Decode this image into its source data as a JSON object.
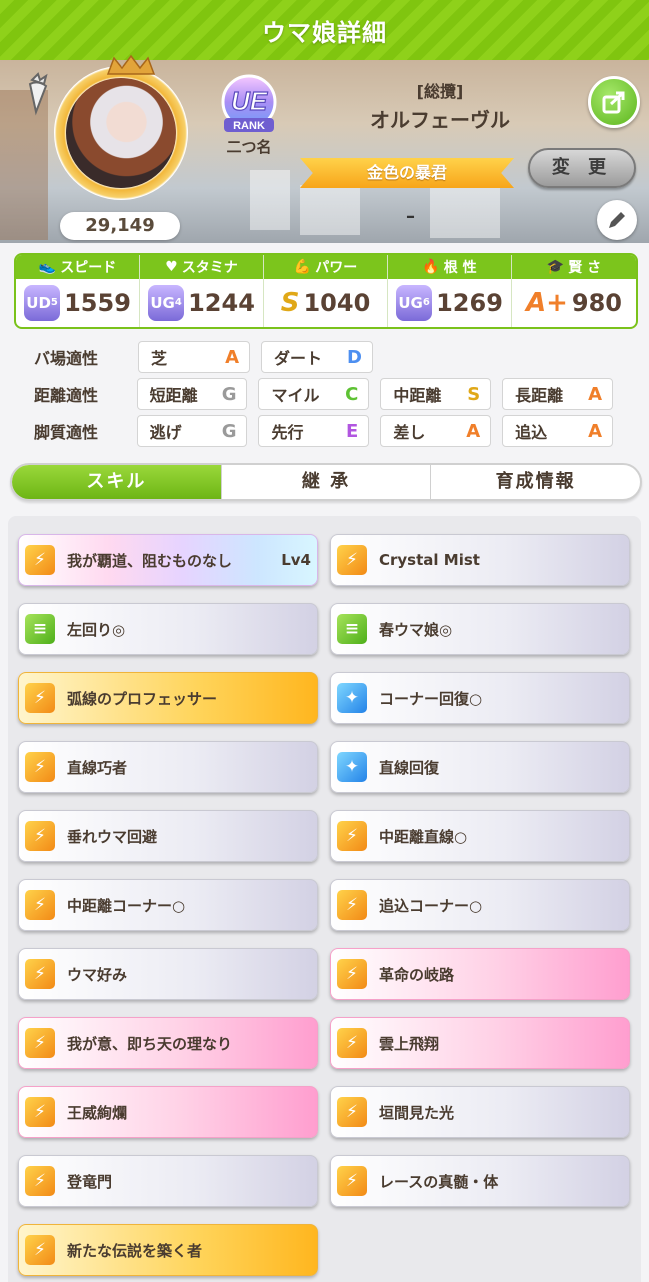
{
  "title": "ウマ娘詳細",
  "profile": {
    "fans": "29,149",
    "rank_label": "UE",
    "rank_word": "RANK",
    "rank_sub": "二つ名",
    "title_tag": "[総攬]",
    "name": "オルフェーヴル",
    "epithet": "金色の暴君",
    "change_label": "変 更",
    "sub_value": "–"
  },
  "stats": [
    {
      "label": "スピード",
      "icon": "shoe-icon",
      "grade": "UD",
      "grade_num": "5",
      "value": "1559"
    },
    {
      "label": "スタミナ",
      "icon": "heart-icon",
      "grade": "UG",
      "grade_num": "4",
      "value": "1244"
    },
    {
      "label": "パワー",
      "icon": "muscle-icon",
      "grade": "S",
      "grade_num": "",
      "value": "1040"
    },
    {
      "label": "根 性",
      "icon": "flame-icon",
      "grade": "UG",
      "grade_num": "6",
      "value": "1269"
    },
    {
      "label": "賢 さ",
      "icon": "grad-cap-icon",
      "grade": "A+",
      "grade_num": "",
      "value": "980"
    }
  ],
  "aptitudes": {
    "ground": {
      "label": "バ場適性",
      "items": [
        {
          "name": "芝",
          "grade": "A"
        },
        {
          "name": "ダート",
          "grade": "D"
        }
      ]
    },
    "distance": {
      "label": "距離適性",
      "items": [
        {
          "name": "短距離",
          "grade": "G"
        },
        {
          "name": "マイル",
          "grade": "C"
        },
        {
          "name": "中距離",
          "grade": "S"
        },
        {
          "name": "長距離",
          "grade": "A"
        }
      ]
    },
    "style": {
      "label": "脚質適性",
      "items": [
        {
          "name": "逃げ",
          "grade": "G"
        },
        {
          "name": "先行",
          "grade": "E"
        },
        {
          "name": "差し",
          "grade": "A"
        },
        {
          "name": "追込",
          "grade": "A"
        }
      ]
    }
  },
  "tabs": [
    {
      "label": "スキル",
      "active": true
    },
    {
      "label": "継 承",
      "active": false
    },
    {
      "label": "育成情報",
      "active": false
    }
  ],
  "skills": [
    {
      "name": "我が覇道、阻むものなし",
      "level": "Lv4",
      "style": "rainbow",
      "icon": "orange"
    },
    {
      "name": "Crystal Mist",
      "level": "",
      "style": "normal",
      "icon": "orange"
    },
    {
      "name": "左回り◎",
      "level": "",
      "style": "normal",
      "icon": "green"
    },
    {
      "name": "春ウマ娘◎",
      "level": "",
      "style": "normal",
      "icon": "green"
    },
    {
      "name": "弧線のプロフェッサー",
      "level": "",
      "style": "gold",
      "icon": "orange"
    },
    {
      "name": "コーナー回復○",
      "level": "",
      "style": "normal",
      "icon": "blue"
    },
    {
      "name": "直線巧者",
      "level": "",
      "style": "normal",
      "icon": "orange"
    },
    {
      "name": "直線回復",
      "level": "",
      "style": "normal",
      "icon": "blue"
    },
    {
      "name": "垂れウマ回避",
      "level": "",
      "style": "normal",
      "icon": "orange"
    },
    {
      "name": "中距離直線○",
      "level": "",
      "style": "normal",
      "icon": "orange"
    },
    {
      "name": "中距離コーナー○",
      "level": "",
      "style": "normal",
      "icon": "orange"
    },
    {
      "name": "追込コーナー○",
      "level": "",
      "style": "normal",
      "icon": "orange"
    },
    {
      "name": "ウマ好み",
      "level": "",
      "style": "normal",
      "icon": "orange"
    },
    {
      "name": "革命の岐路",
      "level": "",
      "style": "pink",
      "icon": "orange"
    },
    {
      "name": "我が意、即ち天の理なり",
      "level": "",
      "style": "pink",
      "icon": "orange"
    },
    {
      "name": "雲上飛翔",
      "level": "",
      "style": "pink",
      "icon": "orange"
    },
    {
      "name": "王威絢爛",
      "level": "",
      "style": "pink",
      "icon": "orange"
    },
    {
      "name": "垣間見た光",
      "level": "",
      "style": "normal",
      "icon": "orange"
    },
    {
      "name": "登竜門",
      "level": "",
      "style": "normal",
      "icon": "orange"
    },
    {
      "name": "レースの真髄・体",
      "level": "",
      "style": "normal",
      "icon": "orange"
    },
    {
      "name": "新たな伝説を築く者",
      "level": "",
      "style": "gold",
      "icon": "orange"
    }
  ]
}
